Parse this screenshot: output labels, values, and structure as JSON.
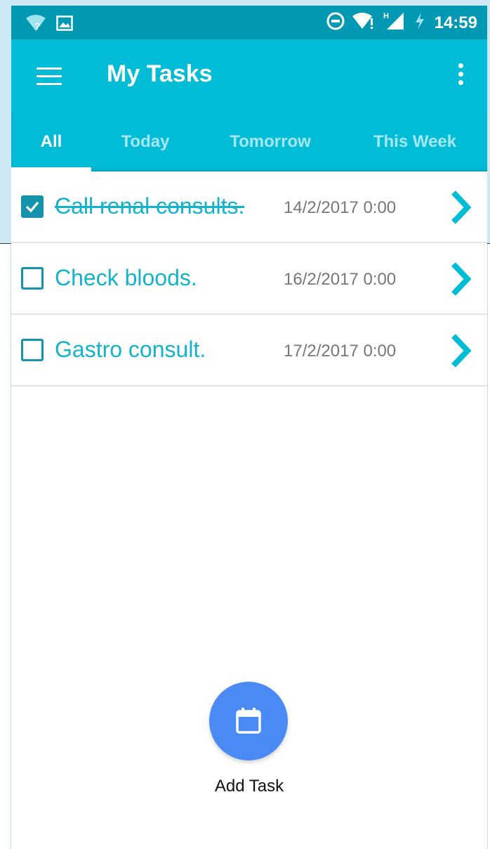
{
  "status_bar": {
    "time": "14:59",
    "network_label": "H",
    "left_icons": [
      "wifi-unknown-icon",
      "image-icon"
    ],
    "right_icons": [
      "do-not-disturb-icon",
      "wifi-alert-icon",
      "cell-signal-icon",
      "battery-charging-icon"
    ]
  },
  "app_bar": {
    "title": "My Tasks",
    "menu_icon": "hamburger-menu-icon",
    "overflow_icon": "more-vert-icon"
  },
  "tabs": [
    {
      "label": "All",
      "active": true
    },
    {
      "label": "Today",
      "active": false
    },
    {
      "label": "Tomorrow",
      "active": false
    },
    {
      "label": "This Week",
      "active": false
    }
  ],
  "tasks": [
    {
      "title": "Call renal consults.",
      "date": "14/2/2017 0:00",
      "done": true
    },
    {
      "title": "Check bloods.",
      "date": "16/2/2017 0:00",
      "done": false
    },
    {
      "title": "Gastro consult.",
      "date": "17/2/2017 0:00",
      "done": false
    }
  ],
  "fab": {
    "label": "Add Task",
    "icon": "calendar-icon"
  },
  "colors": {
    "status_bar": "#0098b2",
    "primary": "#00bcd6",
    "accent_text": "#15b2cc",
    "checkbox": "#1593ad",
    "fab": "#4a8af4",
    "frame": "#cfe9f4"
  }
}
